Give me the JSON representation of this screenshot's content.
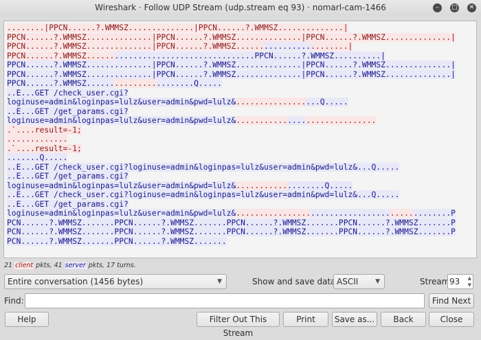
{
  "window": {
    "title": "Wireshark · Follow UDP Stream (udp.stream eq 93) · nomarl-cam-1466"
  },
  "colors": {
    "client_bg": "#fbe6e6",
    "client_fg": "#8b1a1a",
    "server_bg": "#e8e8f8",
    "server_fg": "#1a1a8b"
  },
  "stream_lines": [
    [
      [
        "c",
        "........|PPCN......?.WMMSZ..............|PPCN......?.WMMSZ..............|"
      ]
    ],
    [
      [
        "c",
        "PPCN......?.WMMSZ..............|PPCN......?.WMMSZ..............|PPCN......?.WMMSZ..............|"
      ]
    ],
    [
      [
        "c",
        "PPCN......?.WMMSZ..............|PPCN......?.WMMSZ......"
      ],
      [
        "s",
        ".........."
      ],
      [
        "c",
        "........|"
      ]
    ],
    [
      [
        "c",
        "PPCN......?.WMMSZ......"
      ],
      [
        "s",
        "..............................PPCN......?.WMMSZ..........|"
      ]
    ],
    [
      [
        "s",
        "PPCN......?.WMMSZ..............|PPCN......?.WMMSZ..............|PPCN......?.WMMSZ..............|"
      ]
    ],
    [
      [
        "s",
        "PPCN......?.WMMSZ..............|PPCN......?.WMMSZ..............|PPCN......?.WMMSZ..............|"
      ]
    ],
    [
      [
        "s",
        "PPCN......?.WMMSZ......"
      ],
      [
        "c",
        "........."
      ],
      [
        "s",
        "........Q....."
      ]
    ],
    [
      [
        "s",
        "..E...GET /check_user.cgi?"
      ]
    ],
    [
      [
        "s",
        "loginuse=admin&loginpas=lulz&user=admin&pwd=lulz&"
      ],
      [
        "c",
        "..............."
      ],
      [
        "s",
        "...Q....."
      ]
    ],
    [
      [
        "s",
        "..E...GET /get_params.cgi?"
      ]
    ],
    [
      [
        "s",
        "loginuse=admin&loginpas=lulz&user=admin&pwd=lulz&"
      ],
      [
        "c",
        "..........."
      ],
      [
        "s",
        "...."
      ],
      [
        "c",
        "..............."
      ]
    ],
    [
      [
        "c",
        ".`....result=-1;"
      ]
    ],
    [
      [
        "c",
        "............."
      ]
    ],
    [
      [
        "c",
        ".`....result=-1;"
      ]
    ],
    [
      [
        "s",
        ".......Q....."
      ]
    ],
    [
      [
        "s",
        "..E...GET /check_user.cgi?loginuse=admin&loginpas=lulz&user=admin&pwd=lulz&...Q....."
      ]
    ],
    [
      [
        "s",
        "..E...GET /get_params.cgi?"
      ]
    ],
    [
      [
        "s",
        "loginuse=admin&loginpas=lulz&user=admin&pwd=lulz&"
      ],
      [
        "c",
        "..........."
      ],
      [
        "s",
        "........Q....."
      ]
    ],
    [
      [
        "s",
        "..E...GET /check_user.cgi?loginuse=admin&loginpas=lulz&user=admin&pwd=lulz&...Q....."
      ]
    ],
    [
      [
        "s",
        "..E...GET /get_params.cgi?"
      ]
    ],
    [
      [
        "s",
        "loginuse=admin&loginpas=lulz&user=admin&pwd=lulz&"
      ],
      [
        "c",
        "................"
      ],
      [
        "s",
        "................."
      ],
      [
        "c",
        "....."
      ],
      [
        "s",
        "........P"
      ]
    ],
    [
      [
        "s",
        "PCN......?.WMMSZ.......PPCN......?.WMMSZ.......PPCN......?.WMMSZ.......PPCN......?.WMMSZ.......P"
      ]
    ],
    [
      [
        "s",
        "PCN......?.WMMSZ.......PPCN......?.WMMSZ.......PPCN......?.WMMSZ.......PPCN......?.WMMSZ.......P"
      ]
    ],
    [
      [
        "s",
        "PCN......?.WMMSZ.......PPCN......?.WMMSZ......."
      ]
    ]
  ],
  "stats": {
    "client_count": "21",
    "client": "client",
    "mid": "pkts, 41",
    "server": "server",
    "tail": "pkts, 17 turns."
  },
  "controls": {
    "conversation": "Entire conversation (1456 bytes)",
    "show_label": "Show and save data as",
    "format": "ASCII",
    "stream_label": "Stream",
    "stream_value": "93",
    "find_label": "Find:",
    "find_value": "",
    "find_next": "Find Next"
  },
  "buttons": {
    "help": "Help",
    "filter_out": "Filter Out This Stream",
    "print": "Print",
    "save_as": "Save as...",
    "back": "Back",
    "close": "Close"
  }
}
